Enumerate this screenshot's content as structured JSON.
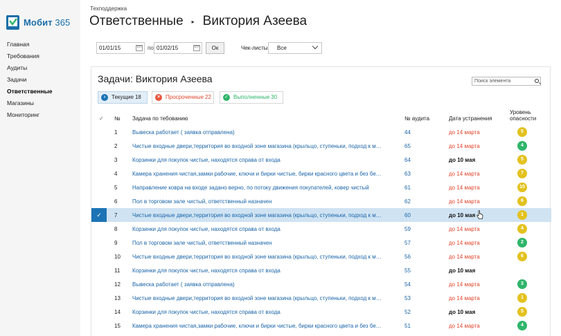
{
  "app": {
    "name": "Мобит",
    "name_num": "365",
    "colors": {
      "brand": "#1a6ea8",
      "accent": "#1c73b5",
      "link": "#1a64a8",
      "danger": "#e0442c",
      "success": "#2fb56a",
      "warning": "#e3c21f"
    }
  },
  "sidebar": {
    "items": [
      {
        "label": "Главная",
        "active": false
      },
      {
        "label": "Требования",
        "active": false
      },
      {
        "label": "Аудиты",
        "active": false
      },
      {
        "label": "Задачи",
        "active": false
      },
      {
        "label": "Ответственные",
        "active": true
      },
      {
        "label": "Магазины",
        "active": false
      },
      {
        "label": "Мониторинг",
        "active": false
      }
    ]
  },
  "header": {
    "breadcrumb": "Техподдержка",
    "title": "Ответственные",
    "separator": "▸",
    "subtitle": "Виктория Азеева"
  },
  "filters": {
    "date_from": "01/01/15",
    "po_label": "по",
    "date_to": "01/02/15",
    "ok_label": "Ок",
    "checklist_label": "Чек-листы",
    "checklist_value": "Все"
  },
  "panel": {
    "title": "Задачи: Виктория Азеева",
    "search_placeholder": "Поиск элемента",
    "tabs": [
      {
        "label": "Текущие",
        "count": "18",
        "icon": "chevron-right-icon",
        "color": "#1c73b5",
        "active": true
      },
      {
        "label": "Просроченные",
        "count": "22",
        "icon": "x-icon",
        "color": "#e8573d",
        "active": false
      },
      {
        "label": "Выполненные",
        "count": "30",
        "icon": "check-icon",
        "color": "#2fb56a",
        "active": false
      }
    ],
    "columns": {
      "check": "✓",
      "num": "№",
      "task": "Задача по тебованию",
      "audit": "№ аудита",
      "date": "Дата устранения",
      "level_1": "Уровень",
      "level_2": "опасности"
    },
    "rows": [
      {
        "num": "1",
        "task": "Вывеска работает ( заявка отправлена)",
        "audit": "44",
        "date": "до 14 марта",
        "date_color": "red",
        "level": "5",
        "level_color": "yellow",
        "selected": false
      },
      {
        "num": "2",
        "task": "Чистые входные двери,территория во входной зоне магазина (крыльцо, ступеньки, подход к магазину) чистая",
        "audit": "65",
        "date": "до 14 марта",
        "date_color": "red",
        "level": "4",
        "level_color": "green",
        "selected": false
      },
      {
        "num": "3",
        "task": "Корзинки для покупок чистые, находятся справа от входа",
        "audit": "64",
        "date": "до 10 мая",
        "date_color": "black",
        "level": "5",
        "level_color": "yellow",
        "selected": false
      },
      {
        "num": "4",
        "task": "Камера хранения чистая,замки рабочие, ключи и бирки чистые, бирки красного цвета и без белых пятен",
        "audit": "63",
        "date": "до 14 марта",
        "date_color": "red",
        "level": "7",
        "level_color": "yellow",
        "selected": false
      },
      {
        "num": "5",
        "task": "Направление ковра на входе задано верно, по потоку движения покупателей, ковер чистый",
        "audit": "61",
        "date": "до 14 марта",
        "date_color": "red",
        "level": "10",
        "level_color": "yellow",
        "selected": false
      },
      {
        "num": "6",
        "task": "Пол в торговом зале чистый, ответственный назначен",
        "audit": "62",
        "date": "до 14 марта",
        "date_color": "red",
        "level": "6",
        "level_color": "yellow",
        "selected": false
      },
      {
        "num": "7",
        "task": "Чистые входные двери,территория во входной зоне магазина (крыльцо, ступеньки, подход к магазину) чистая",
        "audit": "60",
        "date": "до 10 мая",
        "date_color": "black",
        "level": "1",
        "level_color": "yellow",
        "selected": true
      },
      {
        "num": "8",
        "task": "Корзинки для покупок чистые, находятся справа от входа",
        "audit": "59",
        "date": "до 14 марта",
        "date_color": "red",
        "level": "4",
        "level_color": "yellow",
        "selected": false
      },
      {
        "num": "9",
        "task": "Пол в торговом зале чистый, ответственный назначен",
        "audit": "57",
        "date": "до 14 марта",
        "date_color": "red",
        "level": "2",
        "level_color": "green",
        "selected": false
      },
      {
        "num": "10",
        "task": "Чистые входные двери,территория во входной зоне магазина (крыльцо, ступеньки, подход к магазину) чистая",
        "audit": "56",
        "date": "до 14 марта",
        "date_color": "red",
        "level": "6",
        "level_color": "yellow",
        "selected": false
      },
      {
        "num": "11",
        "task": "Корзинки для покупок чистые, находятся справа от входа",
        "audit": "55",
        "date": "до 10 мая",
        "date_color": "black",
        "level": "",
        "level_color": "",
        "selected": false
      },
      {
        "num": "12",
        "task": "Вывеска работает ( заявка отправлена)",
        "audit": "54",
        "date": "до 14 марта",
        "date_color": "red",
        "level": "3",
        "level_color": "green",
        "selected": false
      },
      {
        "num": "13",
        "task": "Чистые входные двери,территория во входной зоне магазина (крыльцо, ступеньки, подход к магазину) чистая",
        "audit": "53",
        "date": "до 14 марта",
        "date_color": "red",
        "level": "1",
        "level_color": "yellow",
        "selected": false
      },
      {
        "num": "14",
        "task": "Корзинки для покупок чистые, находятся справа от входа",
        "audit": "52",
        "date": "до 10 мая",
        "date_color": "black",
        "level": "5",
        "level_color": "yellow",
        "selected": false
      },
      {
        "num": "15",
        "task": "Камера хранения чистая,замки рабочие, ключи и бирки чистые, бирки красного цвета и без белых пятен",
        "audit": "51",
        "date": "до 14 марта",
        "date_color": "red",
        "level": "4",
        "level_color": "green",
        "selected": false
      }
    ]
  }
}
